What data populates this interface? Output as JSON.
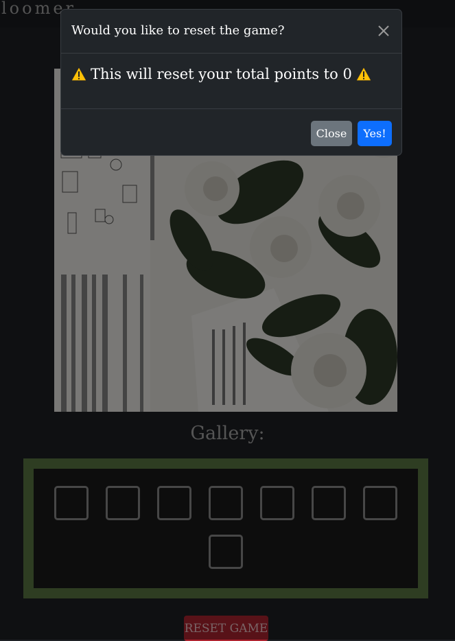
{
  "navbar": {
    "brand": "loomer"
  },
  "gallery": {
    "title": "Gallery:",
    "slot_count": 8
  },
  "reset_button": {
    "label": "RESET GAME"
  },
  "modal": {
    "title": "Would you like to reset the game?",
    "body_text": "This will reset your total points to 0",
    "close_label": "Close",
    "confirm_label": "Yes!"
  },
  "colors": {
    "gallery_border": "#5c7a45",
    "reset": "#b02431",
    "confirm": "#0d6efd",
    "close": "#6c757d",
    "warning": "#ffc107"
  },
  "icons": {
    "close": "close-icon",
    "warning": "warning-icon"
  }
}
